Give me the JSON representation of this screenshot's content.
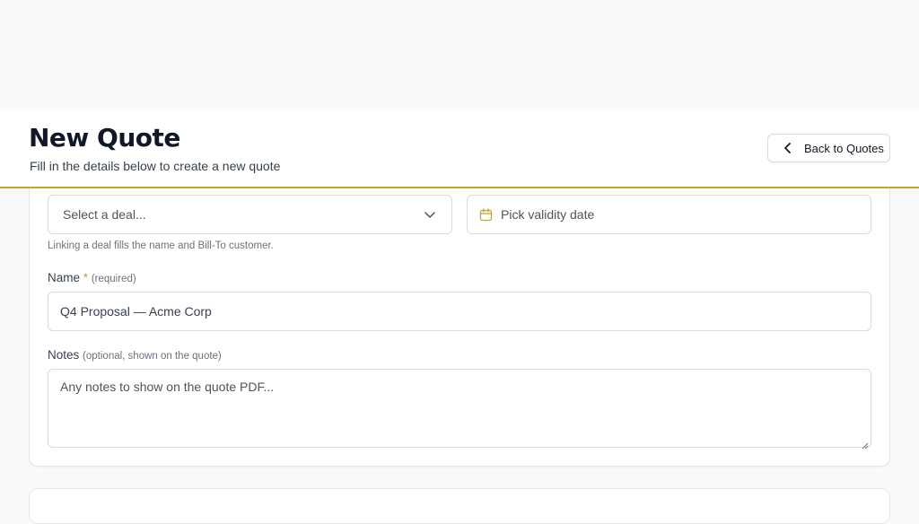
{
  "header": {
    "title": "New Quote",
    "subtitle": "Fill in the details below to create a new quote",
    "back_label": "Back to Quotes"
  },
  "form": {
    "deal_select": {
      "placeholder": "Select a deal...",
      "icon": "chevron-down-icon"
    },
    "validity_date": {
      "placeholder": "Pick validity date",
      "icon": "calendar-icon"
    },
    "deal_hint": "Linking a deal fills the name and Bill-To customer.",
    "name": {
      "label": "Name",
      "required_mark": "*",
      "required_note": "(required)",
      "value": "Q4 Proposal — Acme Corp"
    },
    "notes": {
      "label": "Notes",
      "note": "(optional, shown on the quote)",
      "placeholder": "Any notes to show on the quote PDF..."
    }
  },
  "colors": {
    "accent": "#c5a32e",
    "background": "#f8f9fb",
    "border": "#d8dbe0"
  }
}
